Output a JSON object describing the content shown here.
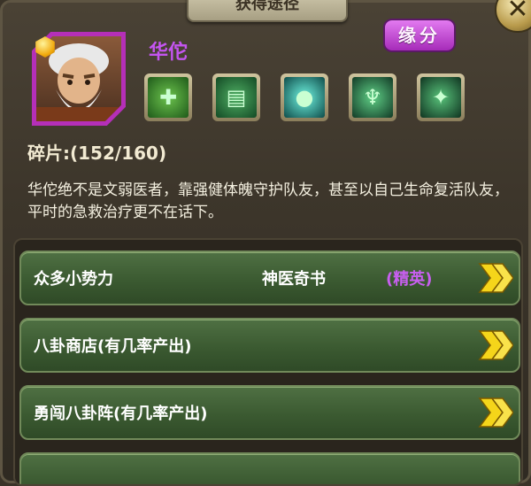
{
  "header": {
    "title": "获得途径"
  },
  "hero": {
    "name": "华佗",
    "fate_button": "缘分",
    "shards_label": "碎片:",
    "shards_value": "(152/160)",
    "description": "华佗绝不是文弱医者，靠强健体魄守护队友，甚至以自己生命复活队友，平时的急救治疗更不在话下。",
    "skills": [
      {
        "icon": "leaf-heal-icon",
        "color": "#2f7a2e"
      },
      {
        "icon": "green-book-icon",
        "color": "#1f6a3a"
      },
      {
        "icon": "cyan-orb-icon",
        "color": "#0f5a5a"
      },
      {
        "icon": "body-silhouette-icon",
        "color": "#1d4f36"
      },
      {
        "icon": "figure-silhouette-icon",
        "color": "#1a4a33"
      }
    ]
  },
  "sources": [
    {
      "label": "众多小势力",
      "middle": "神医奇书",
      "tag": "(精英)"
    },
    {
      "label": "八卦商店(有几率产出)",
      "middle": "",
      "tag": ""
    },
    {
      "label": "勇闯八卦阵(有几率产出)",
      "middle": "",
      "tag": ""
    }
  ],
  "colors": {
    "accent_purple": "#c455f0",
    "row_green": "#3b5a31",
    "chevron_yellow": "#f5d51a"
  }
}
